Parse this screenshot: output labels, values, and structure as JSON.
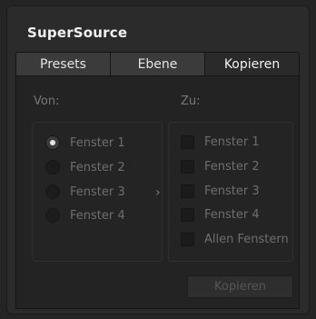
{
  "panel": {
    "title": "SuperSource"
  },
  "tabs": [
    {
      "label": "Presets",
      "active": false
    },
    {
      "label": "Ebene",
      "active": false
    },
    {
      "label": "Kopieren",
      "active": true
    }
  ],
  "from": {
    "label": "Von:",
    "options": [
      {
        "label": "Fenster 1",
        "selected": true
      },
      {
        "label": "Fenster 2",
        "selected": false
      },
      {
        "label": "Fenster 3",
        "selected": false
      },
      {
        "label": "Fenster 4",
        "selected": false
      }
    ]
  },
  "arrow_glyph": "›",
  "to": {
    "label": "Zu:",
    "options": [
      {
        "label": "Fenster 1",
        "checked": false
      },
      {
        "label": "Fenster 2",
        "checked": false
      },
      {
        "label": "Fenster 3",
        "checked": false
      },
      {
        "label": "Fenster 4",
        "checked": false
      },
      {
        "label": "Allen Fenstern",
        "checked": false
      }
    ]
  },
  "copy_button": {
    "label": "Kopieren",
    "enabled": false
  }
}
